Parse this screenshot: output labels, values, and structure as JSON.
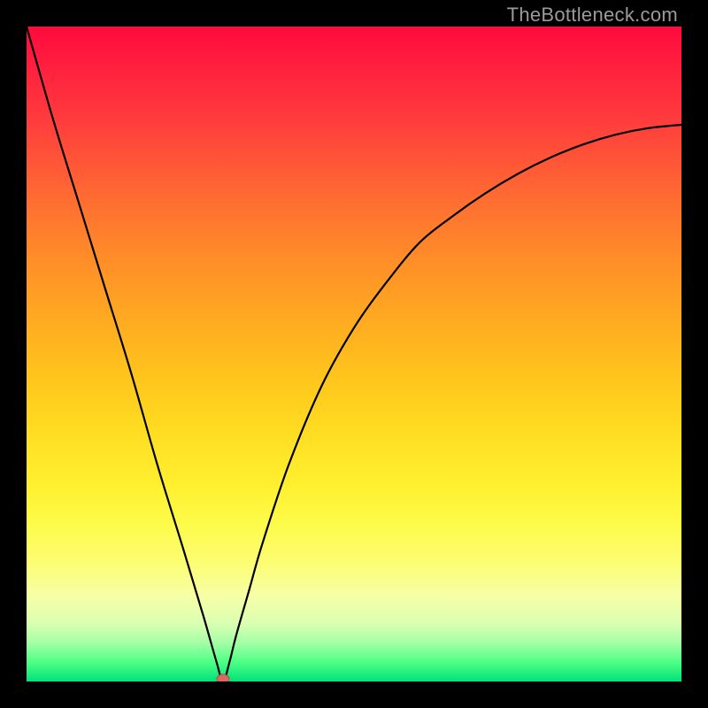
{
  "watermark": "TheBottleneck.com",
  "chart_data": {
    "type": "line",
    "title": "",
    "xlabel": "",
    "ylabel": "",
    "xlim": [
      0,
      100
    ],
    "ylim": [
      0,
      100
    ],
    "grid": false,
    "series": [
      {
        "name": "bottleneck-curve",
        "x": [
          0,
          4,
          8,
          12,
          16,
          20,
          24,
          27,
          29,
          30,
          31,
          32,
          34,
          36,
          40,
          45,
          50,
          55,
          60,
          65,
          70,
          75,
          80,
          85,
          90,
          95,
          100
        ],
        "values": [
          100,
          86,
          73,
          60,
          47,
          33,
          20,
          10,
          3,
          0,
          3,
          7,
          14,
          21,
          33,
          45,
          54,
          61,
          67,
          71,
          74.5,
          77.5,
          80,
          82,
          83.5,
          84.5,
          85
        ]
      }
    ],
    "annotations": [
      {
        "name": "minimum-marker",
        "x": 30,
        "y": 0
      }
    ],
    "background_gradient": {
      "top": "#ff0a3c",
      "middle": "#ffd91f",
      "bottom": "#00e27a"
    }
  }
}
